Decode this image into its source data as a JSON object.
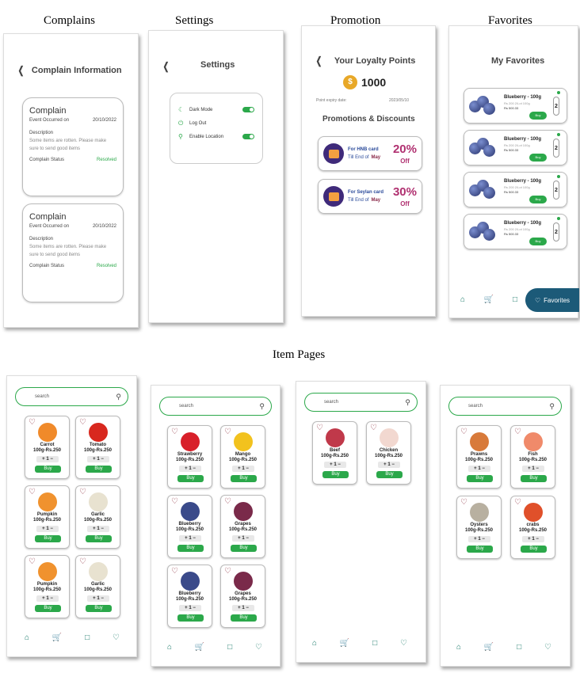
{
  "captions": {
    "complains": "Complains",
    "settings": "Settings",
    "promotion": "Promotion",
    "favorites": "Favorites",
    "item_pages": "Item Pages"
  },
  "complains": {
    "title": "Complain Information",
    "cards": [
      {
        "title": "Complain",
        "event_label": "Event Occurred on",
        "event_date": "20/10/2022",
        "desc_label": "Description",
        "desc": "Some items are rotten. Please make sure to send good items",
        "status_label": "Complain Status",
        "status": "Resolved"
      },
      {
        "title": "Complain",
        "event_label": "Event Occurred on",
        "event_date": "20/10/2022",
        "desc_label": "Description",
        "desc": "Some items are rotten. Please make sure to send good items",
        "status_label": "Complain Status",
        "status": "Resolved"
      }
    ]
  },
  "settings": {
    "title": "Settings",
    "items": [
      {
        "label": "Dark Mode",
        "icon": "moon-off-icon",
        "toggle": true
      },
      {
        "label": "Log Out",
        "icon": "power-icon",
        "toggle": false
      },
      {
        "label": "Enable Location",
        "icon": "location-icon",
        "toggle": true
      }
    ]
  },
  "promotion": {
    "title": "Your Loyalty Points",
    "points": "1000",
    "expiry_label": "Point  expiry date:",
    "expiry_date": "2023/05/10",
    "section": "Promotions & Discounts",
    "cards": [
      {
        "card": "For HNB card",
        "till": "Till End of",
        "month": "May",
        "pct": "20%",
        "off": "Off"
      },
      {
        "card": "For Seylan card",
        "till": "Till End of",
        "month": "May",
        "pct": "30%",
        "off": "Off"
      }
    ]
  },
  "favorites": {
    "title": "My Favorites",
    "items": [
      {
        "name": "Blueberry - 100g",
        "sub": "Rs 200 2/Lot 100g",
        "price": "Rs 500.33",
        "buy": "Buy",
        "qty": "2"
      },
      {
        "name": "Blueberry - 100g",
        "sub": "Rs 200 2/Lot 100g",
        "price": "Rs 500.33",
        "buy": "Buy",
        "qty": "2"
      },
      {
        "name": "Blueberry - 100g",
        "sub": "Rs 200 2/Lot 100g",
        "price": "Rs 500.33",
        "buy": "Buy",
        "qty": "2"
      },
      {
        "name": "Blueberry - 100g",
        "sub": "Rs 200 2/Lot 100g",
        "price": "Rs 500.33",
        "buy": "Buy",
        "qty": "2"
      }
    ],
    "nav_active": "Favorites"
  },
  "item_pages": [
    {
      "search": "search",
      "items": [
        {
          "name": "Carrot",
          "price": "100g-Rs.250",
          "qty": "+ 1 −",
          "buy": "Buy",
          "color": "#f08a2a"
        },
        {
          "name": "Tomato",
          "price": "100g-Rs.250",
          "qty": "+ 1 −",
          "buy": "Buy",
          "color": "#d8281e"
        },
        {
          "name": "Pumpkin",
          "price": "100g-Rs.250",
          "qty": "+ 1 −",
          "buy": "Buy",
          "color": "#f0922e"
        },
        {
          "name": "Garlic",
          "price": "100g-Rs.250",
          "qty": "+ 1 −",
          "buy": "Buy",
          "color": "#e8e2d0"
        },
        {
          "name": "Pumpkin",
          "price": "100g-Rs.250",
          "qty": "+ 1 −",
          "buy": "Buy",
          "color": "#f0922e"
        },
        {
          "name": "Garlic",
          "price": "100g-Rs.250",
          "qty": "+ 1 −",
          "buy": "Buy",
          "color": "#e8e2d0"
        }
      ]
    },
    {
      "search": "search",
      "items": [
        {
          "name": "Strawberry",
          "price": "100g-Rs.250",
          "qty": "+ 1 −",
          "buy": "Buy",
          "color": "#d8202a"
        },
        {
          "name": "Mango",
          "price": "100g-Rs.250",
          "qty": "+ 1 −",
          "buy": "Buy",
          "color": "#f2c21e"
        },
        {
          "name": "Blueberry",
          "price": "100g-Rs.250",
          "qty": "+ 1 −",
          "buy": "Buy",
          "color": "#3a4a8a"
        },
        {
          "name": "Grapes",
          "price": "100g-Rs.250",
          "qty": "+ 1 −",
          "buy": "Buy",
          "color": "#7a2a4a"
        },
        {
          "name": "Blueberry",
          "price": "100g-Rs.250",
          "qty": "+ 1 −",
          "buy": "Buy",
          "color": "#3a4a8a"
        },
        {
          "name": "Grapes",
          "price": "100g-Rs.250",
          "qty": "+ 1 −",
          "buy": "Buy",
          "color": "#7a2a4a"
        }
      ]
    },
    {
      "search": "search",
      "items": [
        {
          "name": "Beef",
          "price": "100g-Rs.250",
          "qty": "+ 1 −",
          "buy": "Buy",
          "color": "#c0394a"
        },
        {
          "name": "Chicken",
          "price": "100g-Rs.250",
          "qty": "+ 1 −",
          "buy": "Buy",
          "color": "#f2d8d0"
        }
      ]
    },
    {
      "search": "search",
      "items": [
        {
          "name": "Prawns",
          "price": "100g-Rs.250",
          "qty": "+ 1 −",
          "buy": "Buy",
          "color": "#d87a3a"
        },
        {
          "name": "Fish",
          "price": "100g-Rs.250",
          "qty": "+ 1 −",
          "buy": "Buy",
          "color": "#f08a6a"
        },
        {
          "name": "Oysters",
          "price": "100g-Rs.250",
          "qty": "+ 1 −",
          "buy": "Buy",
          "color": "#b8b0a0"
        },
        {
          "name": "crabs",
          "price": "100g-Rs.250",
          "qty": "+ 1 −",
          "buy": "Buy",
          "color": "#e0502a"
        }
      ]
    }
  ]
}
